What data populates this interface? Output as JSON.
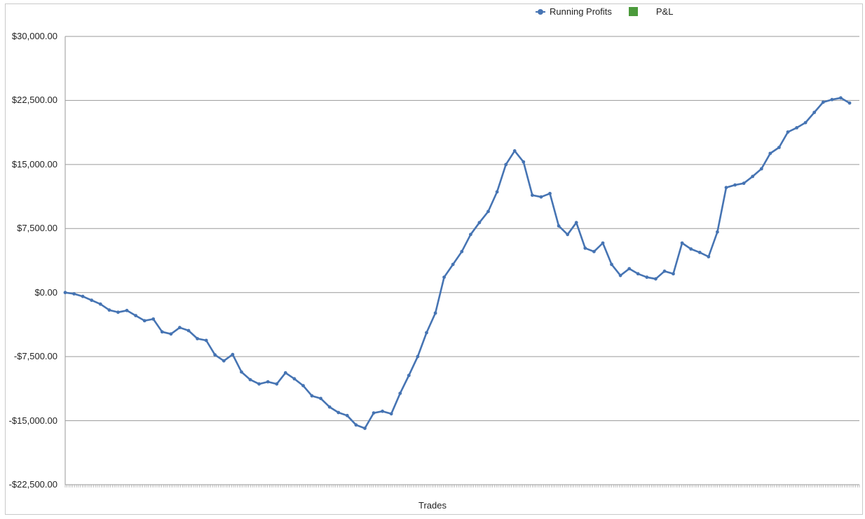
{
  "chart_data": {
    "type": "line",
    "xlabel": "Trades",
    "ylabel": "",
    "ylim": [
      -22500,
      30000
    ],
    "yticks": [
      30000,
      22500,
      15000,
      7500,
      0,
      -7500,
      -15000,
      -22500
    ],
    "ytick_labels": [
      "$30,000.00",
      "$22,500.00",
      "$15,000.00",
      "$7,500.00",
      "$0.00",
      "-$7,500.00",
      "-$15,000.00",
      "-$22,500.00"
    ],
    "grid": true,
    "legend_position": "top-center",
    "series": [
      {
        "name": "Running Profits",
        "color": "#4674b3",
        "marker": "circle",
        "x_range": [
          0,
          100
        ],
        "values": [
          0,
          -150,
          -450,
          -900,
          -1350,
          -2050,
          -2300,
          -2100,
          -2700,
          -3300,
          -3100,
          -4600,
          -4850,
          -4100,
          -4450,
          -5400,
          -5600,
          -7300,
          -8000,
          -7250,
          -9300,
          -10200,
          -10700,
          -10450,
          -10700,
          -9400,
          -10100,
          -10900,
          -12100,
          -12400,
          -13400,
          -14050,
          -14400,
          -15500,
          -15900,
          -14100,
          -13900,
          -14200,
          -11800,
          -9700,
          -7500,
          -4700,
          -2400,
          1800,
          3300,
          4800,
          6800,
          8200,
          9500,
          11800,
          15000,
          16600,
          15300,
          11400,
          11200,
          11600,
          7800,
          6800,
          8200,
          5200,
          4800,
          5800,
          3300,
          2000,
          2800,
          2200,
          1800,
          1600,
          2500,
          2200,
          5800,
          5100,
          4700,
          4200,
          7100,
          12300,
          12600,
          12800,
          13600,
          14500,
          16300,
          17000,
          18800,
          19300,
          19900,
          21100,
          22300,
          22600,
          22800,
          22200
        ]
      },
      {
        "name": "P&L",
        "color": "#4b9a3b",
        "marker": "bar",
        "values": []
      }
    ]
  }
}
